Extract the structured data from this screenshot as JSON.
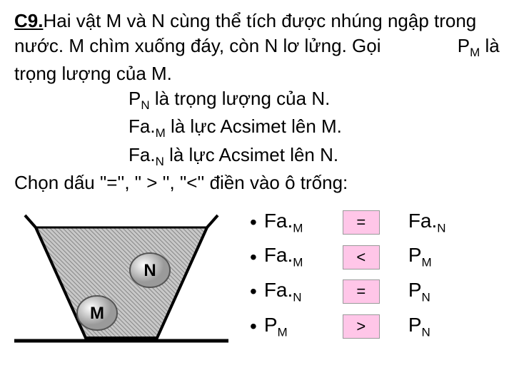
{
  "problem": {
    "label": "C9.",
    "text_main": "Hai vật M và N cùng thể tích được nhúng ngập trong nước. M chìm xuống đáy, còn N lơ lửng. Gọi",
    "def1_pre": "P",
    "def1_sub": "M",
    "def1_post": " là trọng lượng của M.",
    "def2_pre": "P",
    "def2_sub": "N",
    "def2_post": " là trọng lượng của N.",
    "def3_pre": "Fa.",
    "def3_sub": "M",
    "def3_post": " là lực Acsimet lên M.",
    "def4_pre": "Fa.",
    "def4_sub": "N",
    "def4_post": " là lực Acsimet lên N.",
    "choose": "Chọn dấu \"='', \" > '', \"<'' điền vào ô trống:"
  },
  "labels": {
    "M": "M",
    "N": "N"
  },
  "rows": [
    {
      "bul": "•",
      "l_pre": "Fa.",
      "l_sub": "M",
      "box": "=",
      "r_pre": "Fa.",
      "r_sub": "N"
    },
    {
      "bul": "•",
      "l_pre": "Fa.",
      "l_sub": "M",
      "box": "<",
      "r_pre": "P",
      "r_sub": "M"
    },
    {
      "bul": "•",
      "l_pre": "Fa.",
      "l_sub": "N",
      "box": "=",
      "r_pre": "P",
      "r_sub": "N"
    },
    {
      "bul": "•",
      "l_pre": "P",
      "l_sub": "M",
      "box": ">",
      "r_pre": "P",
      "r_sub": "N"
    }
  ],
  "chart_data": {
    "type": "table",
    "title": "Fill comparison signs",
    "categories": [
      "Fa.M vs Fa.N",
      "Fa.M vs P.M",
      "Fa.N vs P.N",
      "P.M vs P.N"
    ],
    "values": [
      "=",
      "<",
      "=",
      ">"
    ]
  }
}
